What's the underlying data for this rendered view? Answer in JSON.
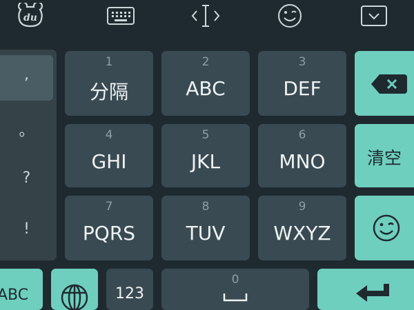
{
  "toolbar": {
    "logo": "du",
    "icons": [
      "keyboard-icon",
      "cursor-move-icon",
      "emoji-icon",
      "collapse-icon"
    ]
  },
  "punctuation": [
    ",",
    "。",
    "?",
    "!"
  ],
  "keys": [
    {
      "num": "1",
      "label": "分隔"
    },
    {
      "num": "2",
      "label": "ABC"
    },
    {
      "num": "3",
      "label": "DEF"
    },
    {
      "num": "4",
      "label": "GHI"
    },
    {
      "num": "5",
      "label": "JKL"
    },
    {
      "num": "6",
      "label": "MNO"
    },
    {
      "num": "7",
      "label": "PQRS"
    },
    {
      "num": "8",
      "label": "TUV"
    },
    {
      "num": "9",
      "label": "WXYZ"
    }
  ],
  "side": {
    "clear_label": "清空"
  },
  "bottom": {
    "abc_label": "ABC",
    "num_label": "123",
    "space_num": "0"
  },
  "colors": {
    "background": "#1f2a30",
    "key": "#3a4a52",
    "accent": "#6fcfbe"
  }
}
